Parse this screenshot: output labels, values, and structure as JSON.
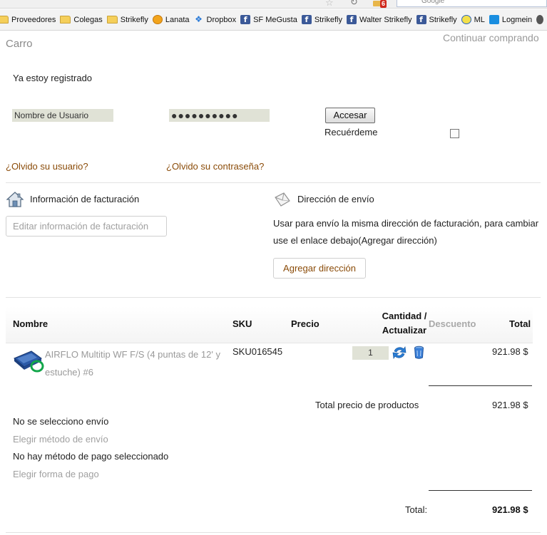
{
  "browser": {
    "search_placeholder": "Google",
    "notification_count": "6",
    "bookmarks": [
      {
        "label": "Proveedores",
        "icon": "folder-icon"
      },
      {
        "label": "Colegas",
        "icon": "folder-icon"
      },
      {
        "label": "Strikefly",
        "icon": "folder-icon"
      },
      {
        "label": "Lanata",
        "icon": "lanata-icon"
      },
      {
        "label": "Dropbox",
        "icon": "dropbox-icon"
      },
      {
        "label": "SF MeGusta",
        "icon": "facebook-icon"
      },
      {
        "label": "Strikefly",
        "icon": "facebook-icon"
      },
      {
        "label": "Walter Strikefly",
        "icon": "facebook-icon"
      },
      {
        "label": "Strikefly",
        "icon": "facebook-icon"
      },
      {
        "label": "ML",
        "icon": "mercadolibre-icon"
      },
      {
        "label": "Logmein",
        "icon": "logmein-icon"
      }
    ]
  },
  "cart": {
    "title": "Carro",
    "continue_label": "Continuar comprando"
  },
  "login": {
    "heading": "Ya estoy registrado",
    "username_placeholder": "Nombre de Usuario",
    "password_mask": "●●●●●●●●●●",
    "submit_label": "Accesar",
    "remember_label": "Recuérdeme",
    "forgot_user": "¿Olvido su usuario?",
    "forgot_pass": "¿Olvido su contraseña?"
  },
  "billing": {
    "title": "Información de facturación",
    "edit_label": "Editar información de facturación"
  },
  "shipping": {
    "title": "Dirección de envío",
    "note": "Usar para envío la misma dirección de facturación, para cambiar use el enlace debajo(Agregar dirección)",
    "add_label": "Agregar dirección"
  },
  "table": {
    "headers": {
      "name": "Nombre",
      "sku": "SKU",
      "price": "Precio",
      "qty": "Cantidad / Actualizar",
      "discount": "Descuento",
      "total": "Total"
    },
    "items": [
      {
        "name": "AIRFLO Multitip WF F/S (4 puntas de 12' y estuche) #6",
        "sku": "SKU016545",
        "price": "",
        "qty": "1",
        "total": "921.98 $"
      }
    ]
  },
  "summary": {
    "subtotal_label": "Total precio de productos",
    "subtotal_value": "921.98 $",
    "no_shipping": "No se selecciono envío",
    "choose_shipping": "Elegir método de envío",
    "no_payment": "No hay método de pago seleccionado",
    "choose_payment": "Elegir forma de pago",
    "total_label": "Total:",
    "total_value": "921.98 $"
  },
  "colors": {
    "link": "#8a4b08",
    "muted": "#a0a0a0",
    "field_bg": "#e0e2d6"
  }
}
